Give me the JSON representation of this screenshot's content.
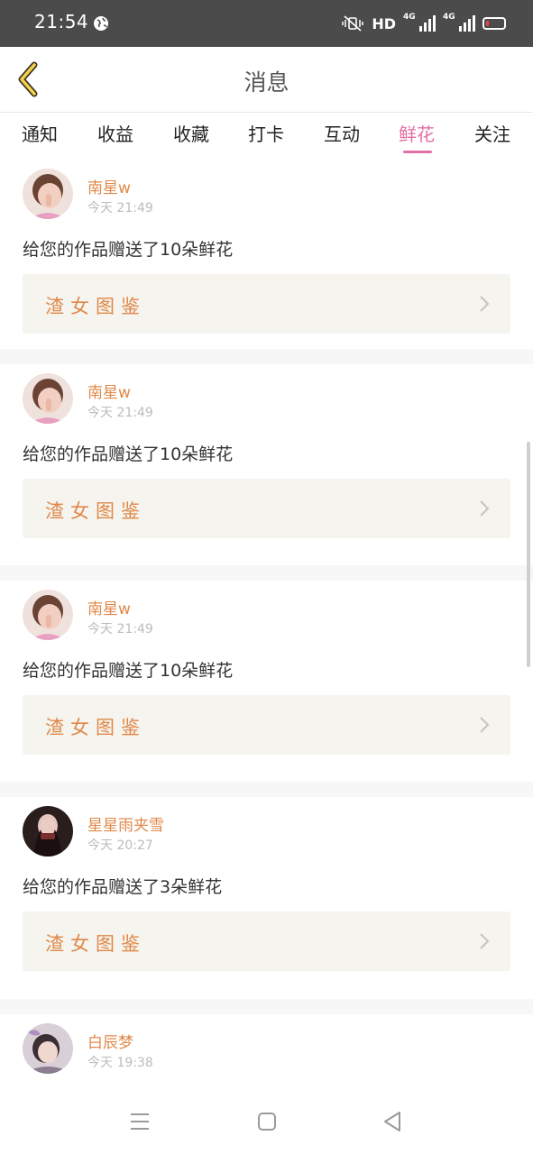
{
  "status": {
    "time": "21:54",
    "hd": "HD",
    "net1": "4G",
    "net2": "4G"
  },
  "header": {
    "title": "消息"
  },
  "tabs": [
    {
      "label": "通知"
    },
    {
      "label": "收益"
    },
    {
      "label": "收藏"
    },
    {
      "label": "打卡"
    },
    {
      "label": "互动"
    },
    {
      "label": "鲜花",
      "active": true
    },
    {
      "label": "关注"
    }
  ],
  "feed": [
    {
      "user": "南星w",
      "time": "今天 21:49",
      "message": "给您的作品赠送了10朵鲜花",
      "work": "渣女图鉴"
    },
    {
      "user": "南星w",
      "time": "今天 21:49",
      "message": "给您的作品赠送了10朵鲜花",
      "work": "渣女图鉴"
    },
    {
      "user": "南星w",
      "time": "今天 21:49",
      "message": "给您的作品赠送了10朵鲜花",
      "work": "渣女图鉴"
    },
    {
      "user": "星星雨夹雪",
      "time": "今天 20:27",
      "message": "给您的作品赠送了3朵鲜花",
      "work": "渣女图鉴"
    },
    {
      "user": "白辰梦",
      "time": "今天 19:38"
    }
  ],
  "colors": {
    "accent_pink": "#e36fa4",
    "name_orange": "#e0894a",
    "link_bg": "#f5f4ee"
  }
}
